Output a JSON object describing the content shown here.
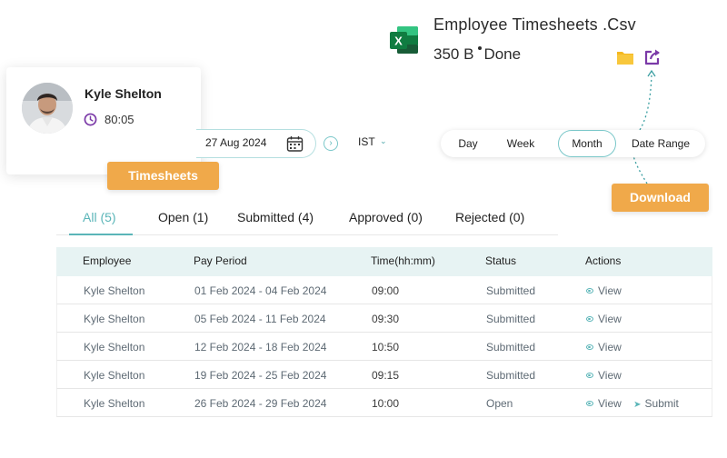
{
  "file": {
    "icon": "excel-file-icon",
    "name": "Employee Timesheets .Csv",
    "size": "350 B",
    "status": "Done",
    "folder_icon": "folder-icon",
    "share_icon": "share-export-icon"
  },
  "user": {
    "name": "Kyle Shelton",
    "time": "80:05",
    "time_icon": "clock-icon"
  },
  "labels": {
    "timesheets": "Timesheets",
    "download": "Download"
  },
  "date_picker": {
    "value": "27 Aug 2024",
    "icon": "calendar-icon",
    "next_icon": "chevron-right-icon",
    "timezone": "IST",
    "timezone_icon": "chevron-down-icon"
  },
  "range": {
    "options": [
      "Day",
      "Week",
      "Month",
      "Date Range"
    ],
    "selected": "Month"
  },
  "tabs": [
    {
      "label": "All (5)",
      "active": true
    },
    {
      "label": "Open (1)",
      "active": false
    },
    {
      "label": "Submitted (4)",
      "active": false
    },
    {
      "label": "Approved (0)",
      "active": false
    },
    {
      "label": "Rejected (0)",
      "active": false
    }
  ],
  "table": {
    "headers": [
      "Employee",
      "Pay Period",
      "Time(hh:mm)",
      "Status",
      "Actions"
    ],
    "rows": [
      {
        "employee": "Kyle Shelton",
        "period": "01 Feb 2024 - 04 Feb 2024",
        "time": "09:00",
        "status": "Submitted",
        "actions": [
          "View"
        ]
      },
      {
        "employee": "Kyle Shelton",
        "period": "05 Feb 2024 - 11 Feb 2024",
        "time": "09:30",
        "status": "Submitted",
        "actions": [
          "View"
        ]
      },
      {
        "employee": "Kyle Shelton",
        "period": "12 Feb 2024 - 18 Feb 2024",
        "time": "10:50",
        "status": "Submitted",
        "actions": [
          "View"
        ]
      },
      {
        "employee": "Kyle Shelton",
        "period": "19 Feb 2024 - 25 Feb 2024",
        "time": "09:15",
        "status": "Submitted",
        "actions": [
          "View"
        ]
      },
      {
        "employee": "Kyle Shelton",
        "period": "26 Feb 2024 - 29 Feb 2024",
        "time": "10:00",
        "status": "Open",
        "actions": [
          "View",
          "Submit"
        ]
      }
    ]
  },
  "colors": {
    "accent": "#5ab5b8",
    "tag": "#f0a94a",
    "header_bg": "#e7f3f3",
    "excel_green": "#1f7a45",
    "share_purple": "#7b3aa8",
    "folder_yellow": "#f5b820"
  }
}
